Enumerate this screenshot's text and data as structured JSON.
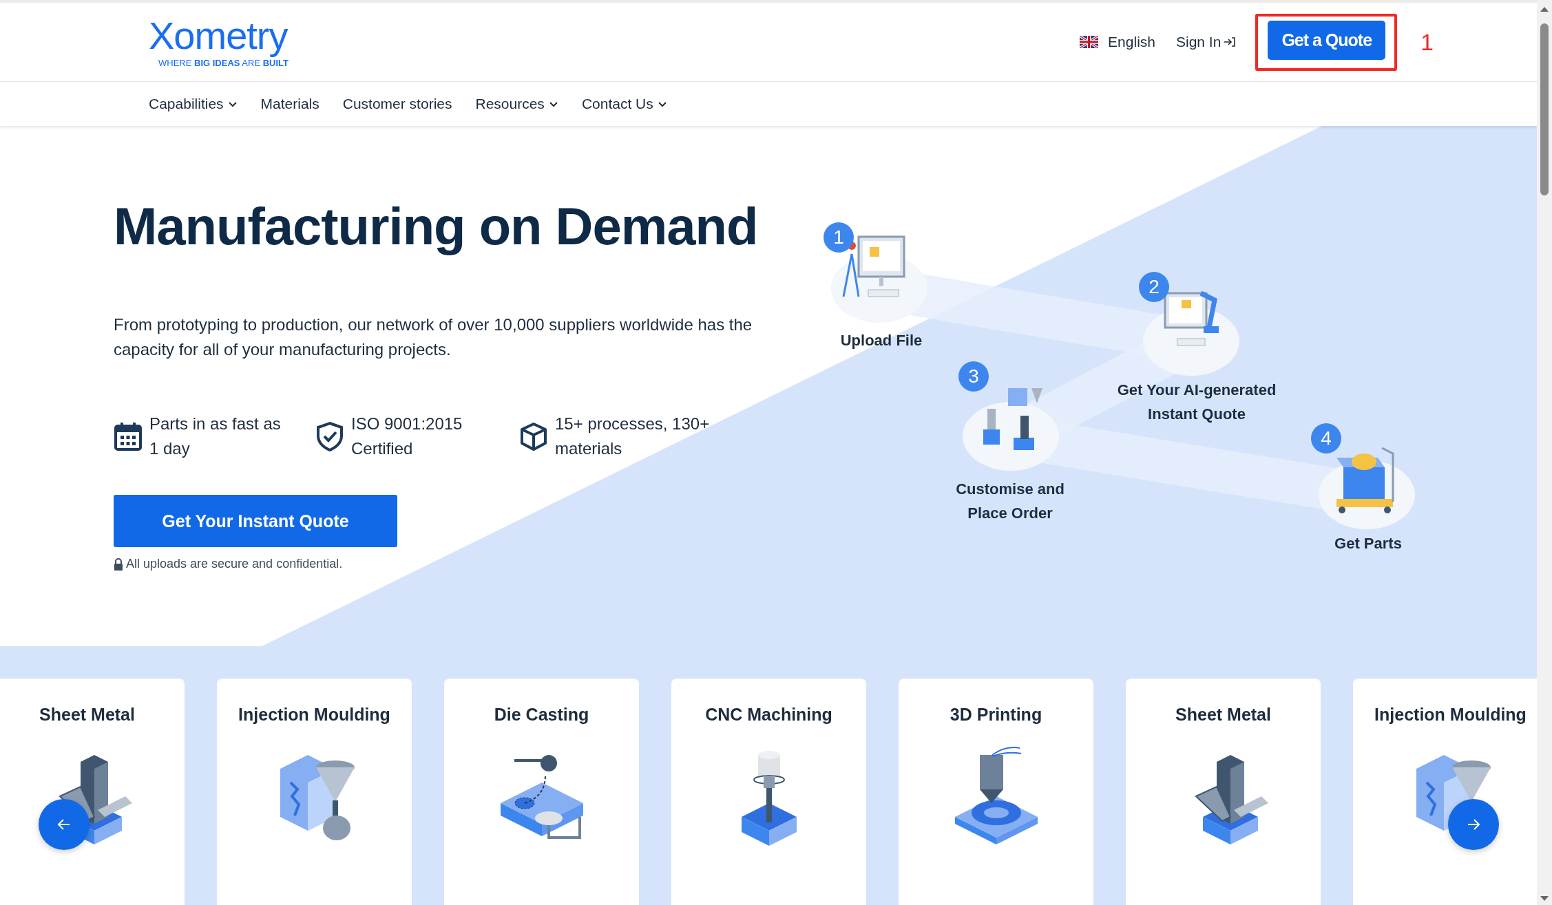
{
  "header": {
    "logo": {
      "wordmark": "Xometry",
      "tagline": "WHERE **BIG IDEAS** ARE **BUILT**"
    },
    "language": {
      "label": "English"
    },
    "sign_in": {
      "label": "Sign In"
    },
    "cta": {
      "label": "Get a Quote"
    },
    "annotation": {
      "label": "1"
    }
  },
  "nav": [
    {
      "label": "Capabilities",
      "has_dropdown": true
    },
    {
      "label": "Materials",
      "has_dropdown": false
    },
    {
      "label": "Customer stories",
      "has_dropdown": false
    },
    {
      "label": "Resources",
      "has_dropdown": true
    },
    {
      "label": "Contact Us",
      "has_dropdown": true
    }
  ],
  "hero": {
    "title": "Manufacturing on Demand",
    "description": "From prototyping to production, our network of over 10,000 suppliers worldwide has the capacity for all of your manufacturing projects.",
    "features": [
      {
        "kind": "calendar",
        "lines": [
          "Parts in as fast as",
          "1 day"
        ]
      },
      {
        "kind": "shield",
        "lines": [
          "ISO 9001:2015",
          "Certified"
        ]
      },
      {
        "kind": "cube",
        "lines": [
          "15+ processes, 130+",
          "materials"
        ]
      }
    ],
    "button": "Get Your Instant Quote",
    "note": "All uploads are secure and confidential."
  },
  "steps": [
    {
      "number": "1",
      "kind": "upload",
      "lines": [
        "Upload File"
      ]
    },
    {
      "number": "2",
      "kind": "quote",
      "lines": [
        "Get Your AI-generated",
        "Instant Quote"
      ]
    },
    {
      "number": "3",
      "kind": "order",
      "lines": [
        "Customise and",
        "Place Order"
      ]
    },
    {
      "number": "4",
      "kind": "parts",
      "lines": [
        "Get Parts"
      ]
    }
  ],
  "cards": [
    {
      "title": "Sheet Metal",
      "kind": "sheet_metal"
    },
    {
      "title": "Injection Moulding",
      "kind": "injection"
    },
    {
      "title": "Die Casting",
      "kind": "die_casting"
    },
    {
      "title": "CNC Machining",
      "kind": "cnc"
    },
    {
      "title": "3D Printing",
      "kind": "printing"
    },
    {
      "title": "Sheet Metal",
      "kind": "sheet_metal"
    },
    {
      "title": "Injection Moulding",
      "kind": "injection"
    }
  ]
}
